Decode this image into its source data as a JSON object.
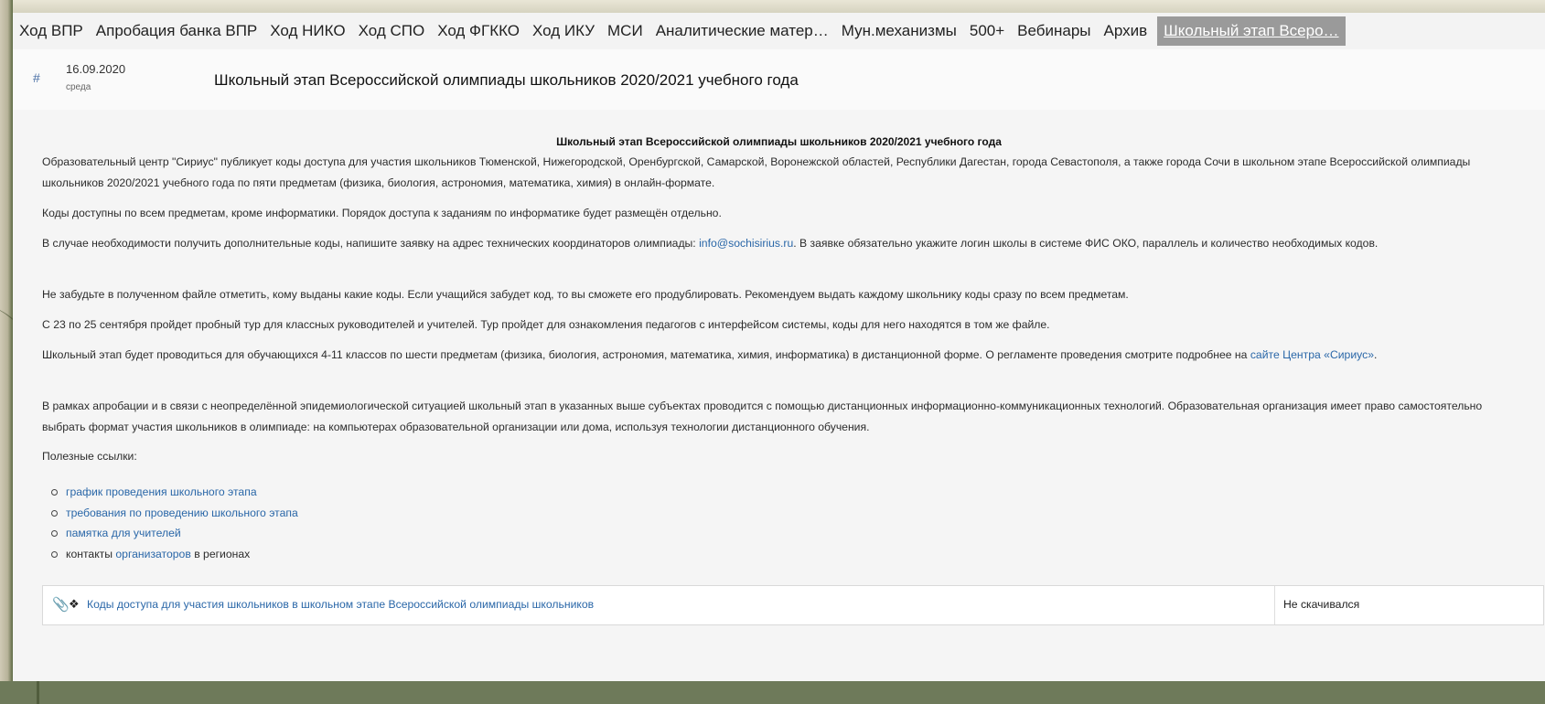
{
  "nav": {
    "tabs": [
      "Ход ВПР",
      "Апробация банка ВПР",
      "Ход НИКО",
      "Ход СПО",
      "Ход ФГККО",
      "Ход ИКУ",
      "МСИ",
      "Аналитические матер…",
      "Мун.механизмы",
      "500+",
      "Вебинары",
      "Архив"
    ],
    "active_tab": "Школьный этап Всеро…"
  },
  "header": {
    "hash": "#",
    "date": "16.09.2020",
    "weekday": "среда",
    "title": "Школьный этап Всероссийской олимпиады школьников 2020/2021 учебного года"
  },
  "content": {
    "title": "Школьный этап Всероссийской олимпиады школьников 2020/2021 учебного года",
    "p1": "Образовательный центр \"Сириус\" публикует коды доступа для участия школьников Тюменской, Нижегородской, Оренбургской, Самарской, Воронежской областей, Республики Дагестан, города Севастополя, а также города Сочи в школьном этапе Всероссийской олимпиады школьников 2020/2021 учебного года по пяти предметам (физика, биология, астрономия, математика, химия) в онлайн-формате.",
    "p2": "Коды доступны по всем предметам, кроме информатики. Порядок доступа к заданиям по информатике будет размещён отдельно.",
    "p3_before": "В случае необходимости получить дополнительные коды, напишите заявку на адрес технических координаторов олимпиады: ",
    "p3_link": "info@sochisirius.ru",
    "p3_after": ". В заявке обязательно укажите логин школы в системе ФИС ОКО, параллель и количество необходимых кодов.",
    "p4": "Не забудьте в полученном файле отметить, кому выданы какие коды. Если учащийся забудет код, то вы сможете его продублировать. Рекомендуем выдать каждому школьнику коды сразу по всем предметам.",
    "p5": "С 23 по 25 сентября пройдет пробный тур для классных руководителей и учителей. Тур пройдет для ознакомления педагогов с интерфейсом системы, коды для него находятся в том же файле.",
    "p6_before": "Школьный этап будет проводиться для обучающихся 4-11 классов по шести предметам (физика, биология, астрономия, математика, химия, информатика) в дистанционной форме. О регламенте проведения смотрите подробнее на ",
    "p6_link": "сайте Центра «Сириус»",
    "p6_after": ".",
    "p7": "В рамках апробации и в связи с неопределённой эпидемиологической ситуацией школьный этап в указанных выше субъектах проводится с помощью дистанционных информационно-коммуникационных технологий. Образовательная организация имеет право самостоятельно выбрать формат участия школьников в олимпиаде: на компьютерах образовательной организации или дома, используя технологии дистанционного обучения.",
    "useful_links_label": "Полезные ссылки:",
    "links": [
      "график проведения школьного этапа",
      "требования по проведению школьного этапа",
      "памятка для учителей"
    ],
    "contacts_prefix": "контакты ",
    "contacts_link": "организаторов",
    "contacts_suffix": " в регионах"
  },
  "attachment": {
    "clip_icon": "paperclip-icon",
    "file_icon": "file-icon",
    "link": "Коды доступа для участия школьников в школьном этапе Всероссийской олимпиады школьников",
    "status": "Не скачивался"
  }
}
